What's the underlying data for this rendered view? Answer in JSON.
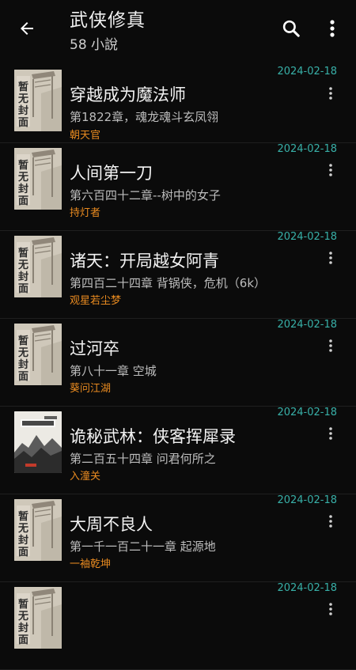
{
  "header": {
    "back_icon": "arrow-left-icon",
    "title": "武侠修真",
    "subtitle": "58 小說",
    "search_icon": "search-icon",
    "more_icon": "more-vertical-icon"
  },
  "colors": {
    "date": "#38b0a8",
    "author": "#e88a20",
    "background": "#0b0b0b"
  },
  "books": [
    {
      "date": "2024-02-18",
      "title": "穿越成为魔法师",
      "chapter": "第1822章，魂龙魂斗玄凤翎",
      "author": "朝天官",
      "cover": "zanwu-fengmian"
    },
    {
      "date": "2024-02-18",
      "title": "人间第一刀",
      "chapter": "第六百四十二章--树中的女子",
      "author": "持灯者",
      "cover": "zanwu-fengmian"
    },
    {
      "date": "2024-02-18",
      "title": "诸天：开局越女阿青",
      "chapter": "第四百二十四章 背锅侠，危机（6k）",
      "author": "观星若尘梦",
      "cover": "zanwu-fengmian"
    },
    {
      "date": "2024-02-18",
      "title": "过河卒",
      "chapter": "第八十一章 空城",
      "author": "葵问江湖",
      "cover": "zanwu-fengmian"
    },
    {
      "date": "2024-02-18",
      "title": "诡秘武林：侠客挥犀录",
      "chapter": "第二百五十四章 问君何所之",
      "author": "入潼关",
      "cover": "ink-painting"
    },
    {
      "date": "2024-02-18",
      "title": "大周不良人",
      "chapter": "第一千一百二十一章 起源地",
      "author": "一袖乾坤",
      "cover": "zanwu-fengmian"
    },
    {
      "date": "2024-02-18",
      "title": "",
      "chapter": "",
      "author": "",
      "cover": "zanwu-fengmian"
    }
  ],
  "cover_text": "暂无封面"
}
